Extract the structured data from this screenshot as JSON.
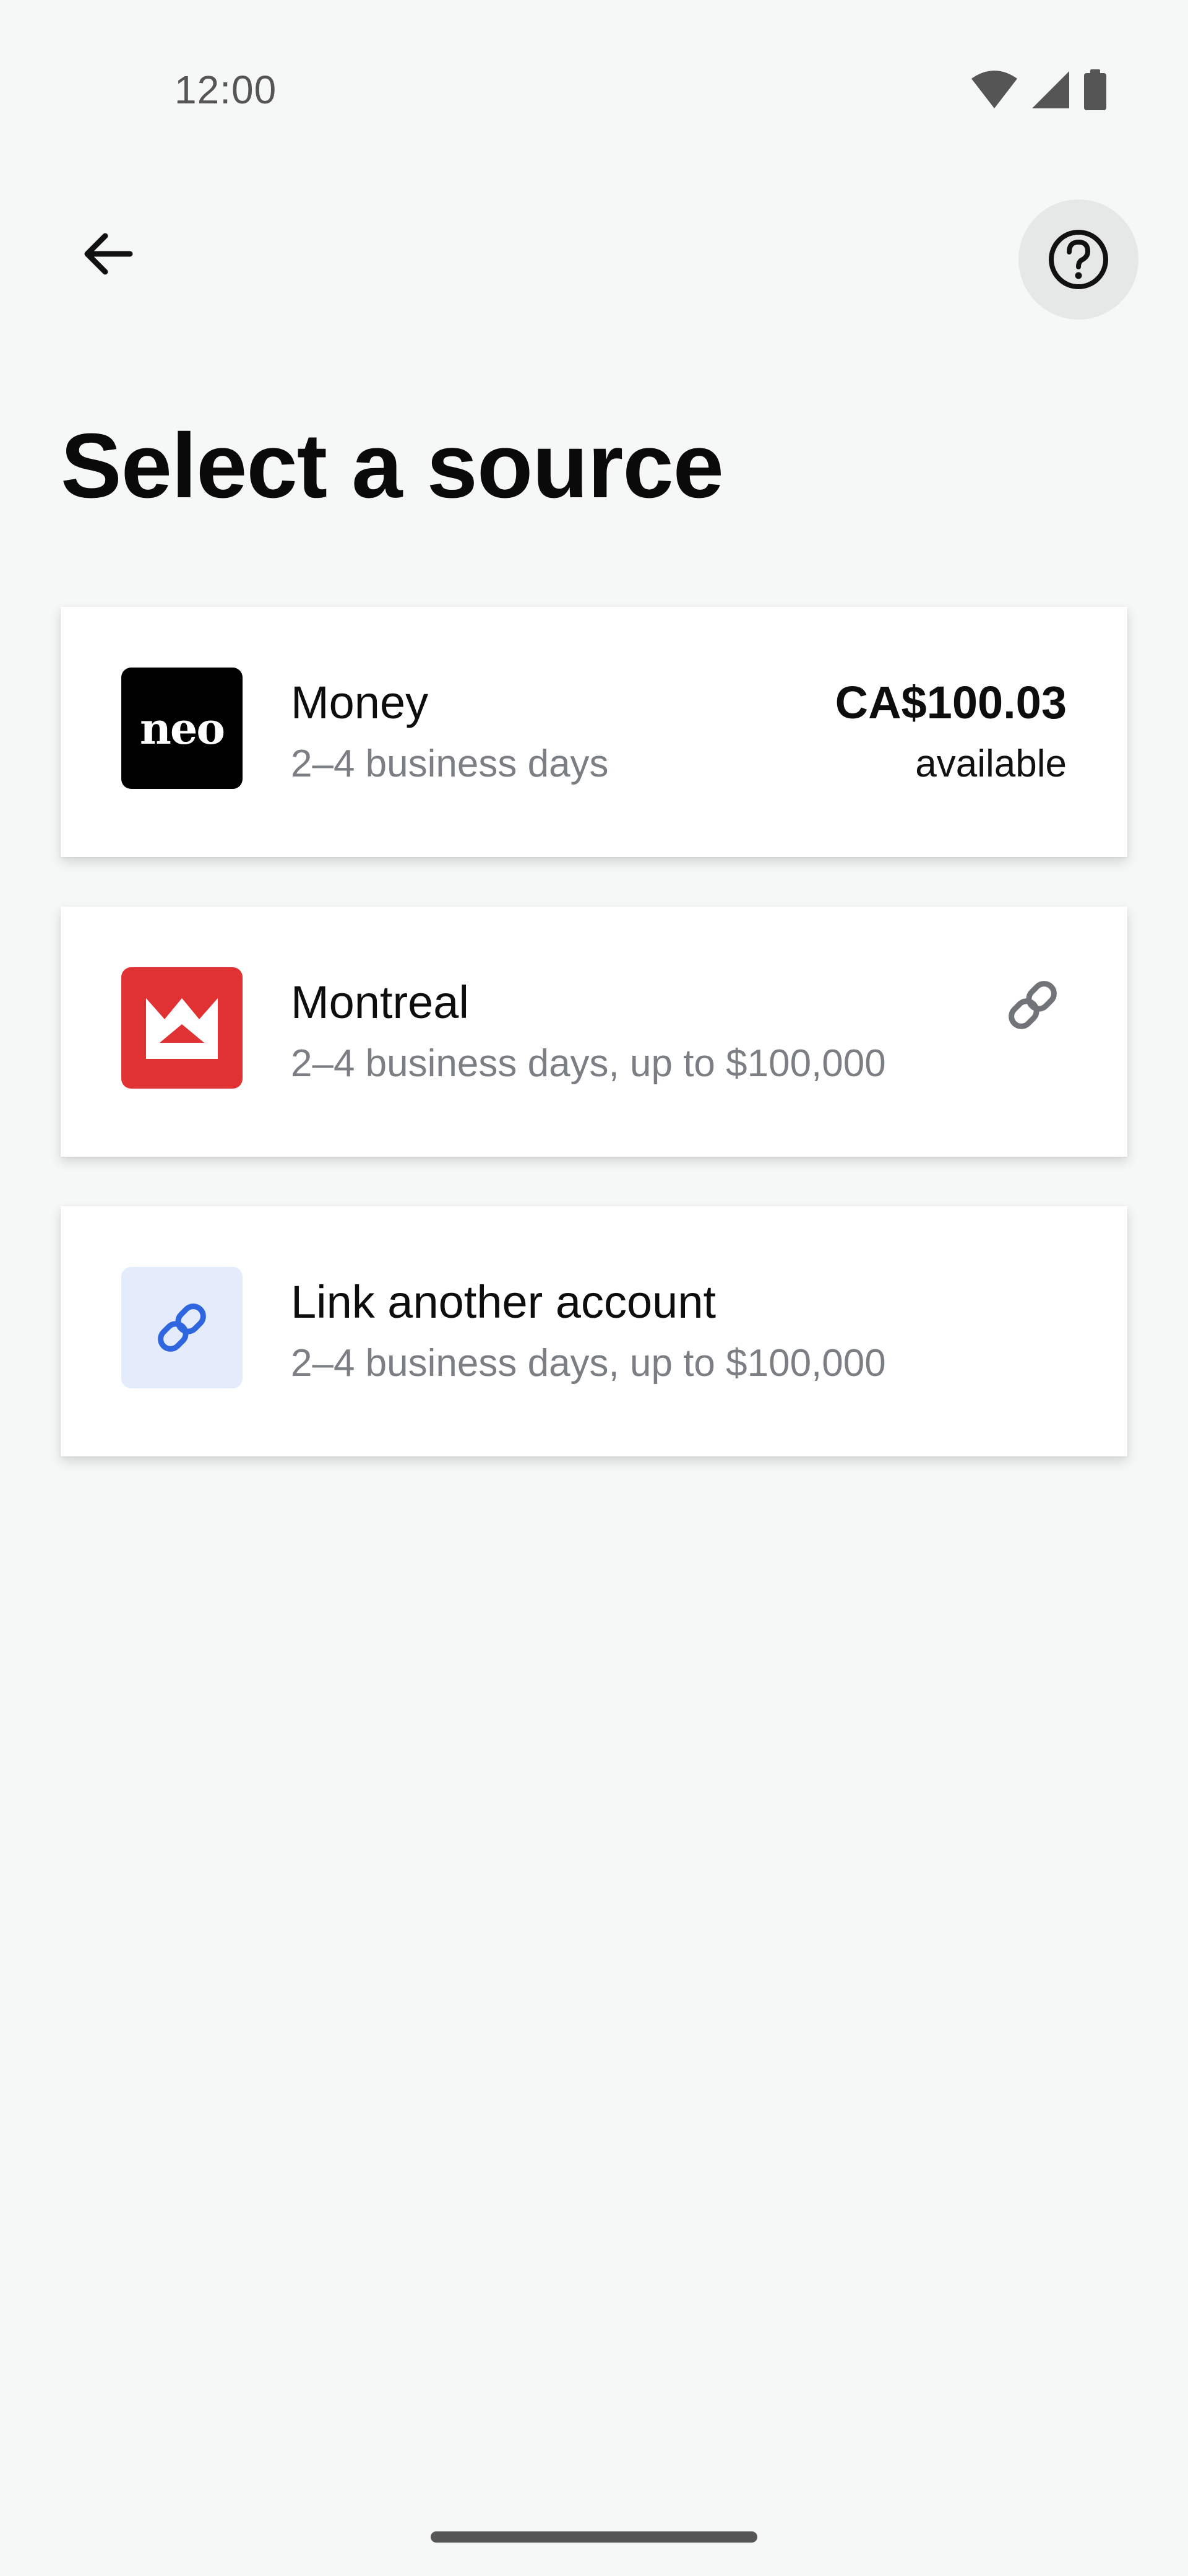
{
  "status_bar": {
    "time": "12:00",
    "icons": [
      "wifi-icon",
      "cell-signal-icon",
      "battery-icon"
    ]
  },
  "header": {
    "back_icon": "arrow-left-icon",
    "help_icon": "help-circle-icon"
  },
  "page": {
    "title": "Select a source"
  },
  "sources": [
    {
      "logo": "neo",
      "logo_text": "neo",
      "title": "Money",
      "subtitle": "2–4 business days",
      "amount": "CA$100.03",
      "amount_note": "available"
    },
    {
      "logo": "bmo-logo-icon",
      "title": "Montreal",
      "subtitle": "2–4 business days, up to $100,000",
      "action_icon": "link-icon"
    },
    {
      "logo": "link-icon",
      "title": "Link another account",
      "subtitle": "2–4 business days, up to $100,000"
    }
  ],
  "colors": {
    "background": "#f6f8f7",
    "bmo_red": "#e03232",
    "link_blue": "#2f66e0",
    "link_tile_bg": "#e4ecfb",
    "muted_text": "#7b7f84"
  }
}
